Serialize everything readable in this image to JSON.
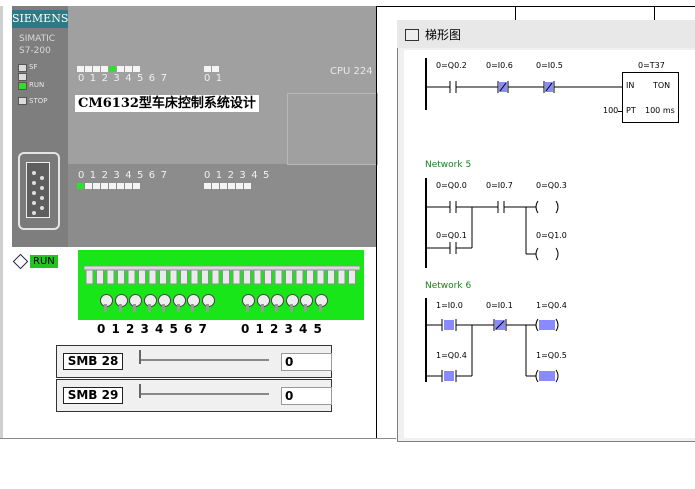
{
  "plc": {
    "brand": "SIEMENS",
    "model_line1": "SIMATIC",
    "model_line2": "S7-200",
    "status_leds": [
      {
        "label": "SF",
        "on": false
      },
      {
        "label": "RUN",
        "on": true
      },
      {
        "label": "STOP",
        "on": false
      }
    ],
    "cpu_label": "CPU 224",
    "title": "CM6132型车床控制系统设计",
    "output_digits_a": [
      "0",
      "1",
      "2",
      "3",
      "4",
      "5",
      "6",
      "7"
    ],
    "output_digits_b": [
      "0",
      "1"
    ],
    "output_leds_a": [
      false,
      false,
      false,
      false,
      true,
      false,
      false,
      false
    ],
    "output_leds_b": [
      false,
      false
    ],
    "input_digits_a": [
      "0",
      "1",
      "2",
      "3",
      "4",
      "5",
      "6",
      "7"
    ],
    "input_digits_b": [
      "0",
      "1",
      "2",
      "3",
      "4",
      "5"
    ],
    "input_leds_a": [
      true,
      false,
      false,
      false,
      false,
      false,
      false,
      false
    ],
    "input_leds_b": [
      false,
      false,
      false,
      false,
      false,
      false
    ],
    "run_badge": "RUN"
  },
  "switches": {
    "digits_a": [
      "0",
      "1",
      "2",
      "3",
      "4",
      "5",
      "6",
      "7"
    ],
    "digits_b": [
      "0",
      "1",
      "2",
      "3",
      "4",
      "5"
    ]
  },
  "sliders": [
    {
      "label": "SMB 28",
      "value": "0"
    },
    {
      "label": "SMB 29",
      "value": "0"
    }
  ],
  "ladder": {
    "window_title": "梯形图",
    "rung1": {
      "c1": "0=Q0.2",
      "c2": "0=I0.6",
      "c3": "0=I0.5",
      "timer_name": "0=T37",
      "timer_in": "IN",
      "timer_type": "TON",
      "pt_value": "100",
      "pt_label": "PT",
      "pt_unit": "100 ms"
    },
    "network5": {
      "label": "Network 5",
      "c1": "0=Q0.0",
      "c2": "0=I0.7",
      "coil1": "0=Q0.3",
      "c3": "0=Q0.1",
      "coil2": "0=Q1.0"
    },
    "network6": {
      "label": "Network 6",
      "c1": "1=I0.0",
      "c2": "0=I0.1",
      "coil1": "1=Q0.4",
      "c3": "1=Q0.4",
      "coil2": "1=Q0.5"
    }
  }
}
